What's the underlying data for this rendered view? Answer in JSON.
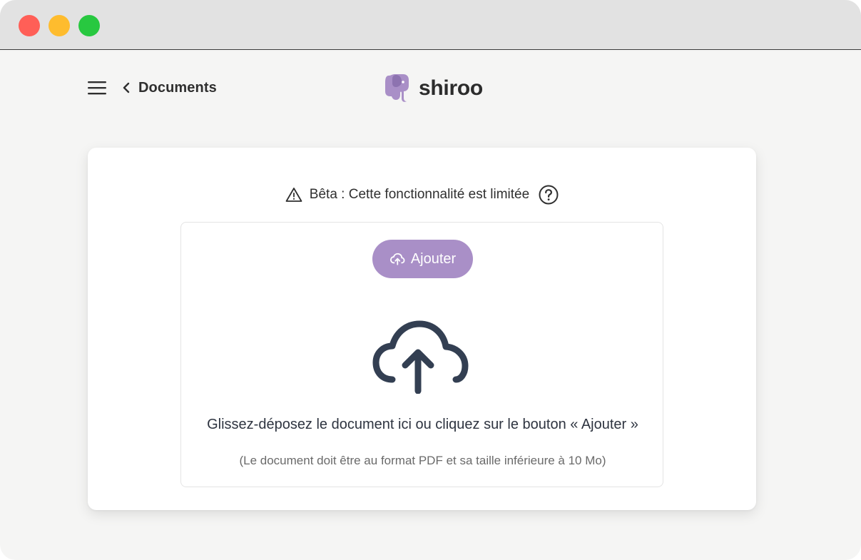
{
  "window": {
    "controls": {
      "close_color": "#ff5f57",
      "minimize_color": "#febc2e",
      "maximize_color": "#28c840"
    }
  },
  "header": {
    "menu_icon": "hamburger-menu-icon",
    "back_icon": "chevron-left-icon",
    "back_label": "Documents",
    "logo_text": "shiroo",
    "logo_icon": "elephant-logo-icon",
    "brand_color": "#a98fc7"
  },
  "beta_notice": {
    "icon": "warning-triangle-icon",
    "text": "Bêta : Cette fonctionnalité est limitée",
    "help_icon": "question-circle-icon"
  },
  "upload": {
    "button_icon": "cloud-upload-icon",
    "button_label": "Ajouter",
    "illustration_icon": "cloud-upload-icon",
    "instruction": "Glissez-déposez le document ici ou cliquez sur le bouton « Ajouter »",
    "constraint": "(Le document doit être au format PDF et sa taille inférieure à 10 Mo)"
  }
}
